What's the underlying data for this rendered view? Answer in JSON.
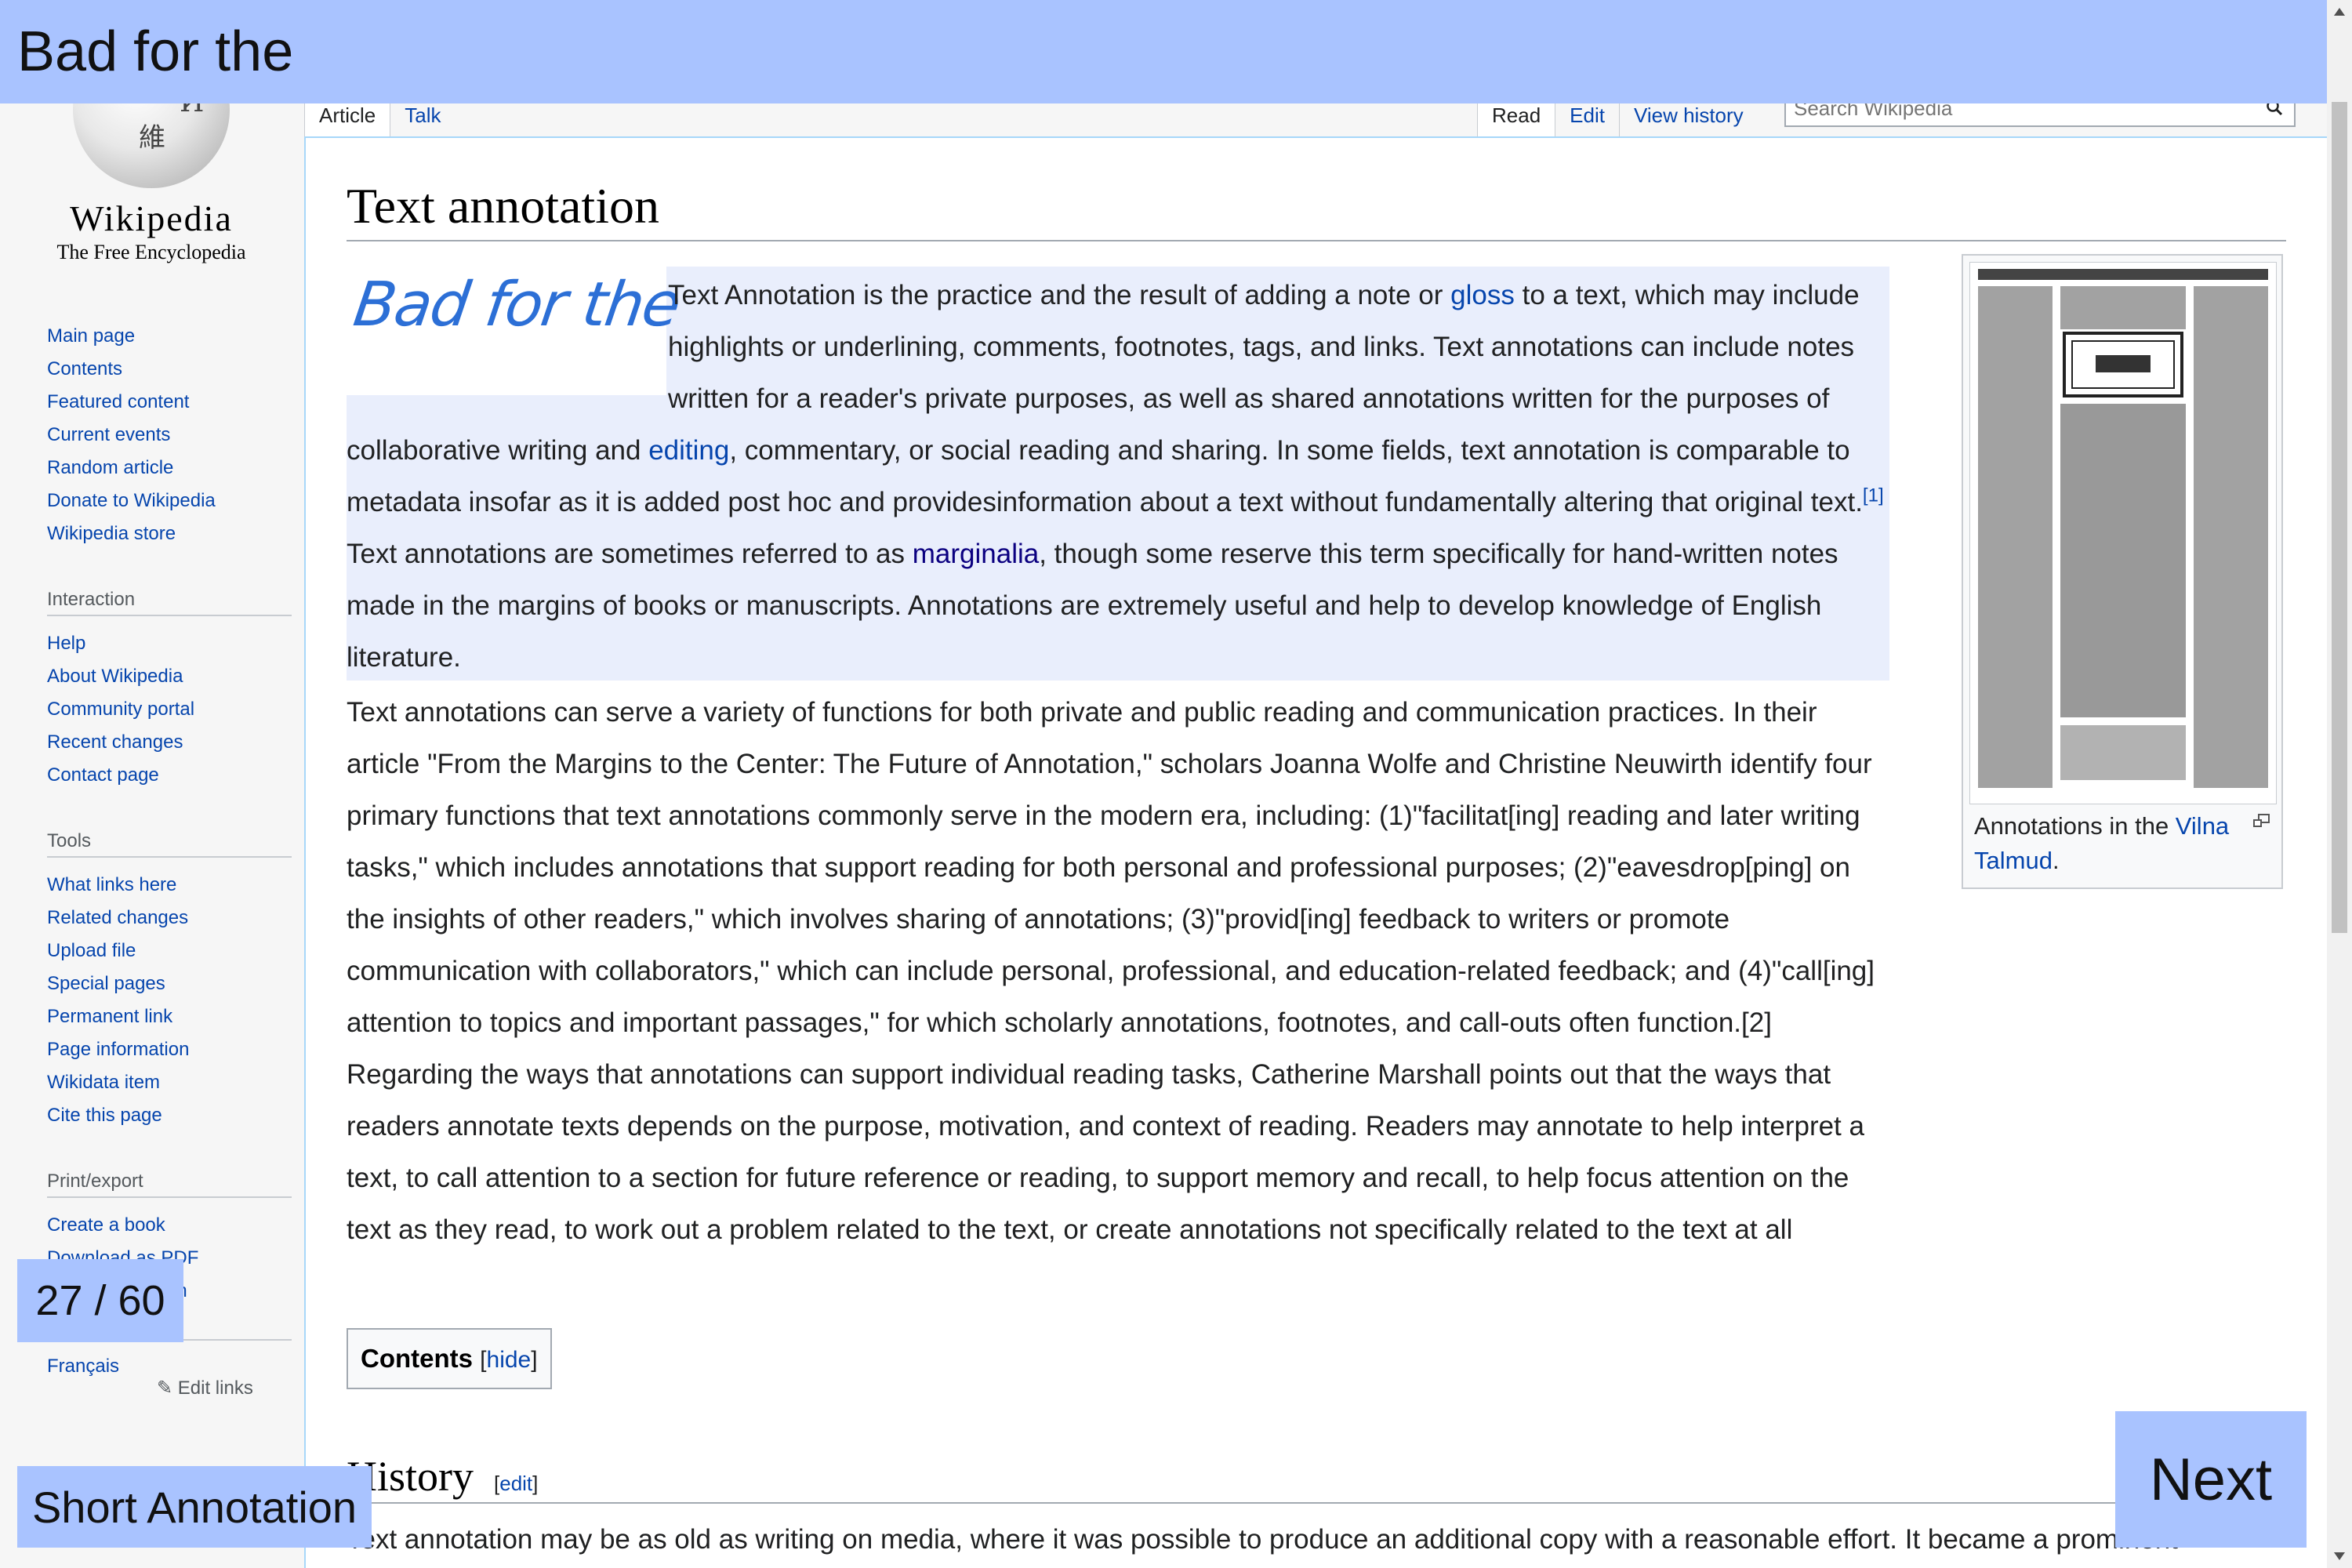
{
  "banner": {
    "text": "Bad for the"
  },
  "logo": {
    "wordmark": "Wikipedia",
    "tagline": "The Free Encyclopedia"
  },
  "sidebar": {
    "navigation": [
      "Main page",
      "Contents",
      "Featured content",
      "Current events",
      "Random article",
      "Donate to Wikipedia",
      "Wikipedia store"
    ],
    "interaction": {
      "heading": "Interaction",
      "items": [
        "Help",
        "About Wikipedia",
        "Community portal",
        "Recent changes",
        "Contact page"
      ]
    },
    "tools": {
      "heading": "Tools",
      "items": [
        "What links here",
        "Related changes",
        "Upload file",
        "Special pages",
        "Permanent link",
        "Page information",
        "Wikidata item",
        "Cite this page"
      ]
    },
    "print": {
      "heading": "Print/export",
      "items": [
        "Create a book",
        "Download as PDF",
        "Printable version"
      ]
    },
    "languages": {
      "items": [
        "Français"
      ],
      "edit_links": "Edit links"
    }
  },
  "tabs": {
    "left": [
      "Article",
      "Talk"
    ],
    "right": [
      "Read",
      "Edit",
      "View history"
    ]
  },
  "search": {
    "placeholder": "Search Wikipedia"
  },
  "article": {
    "title": "Text annotation",
    "handwriting": "Bad for the",
    "para1": {
      "t1": "Text Annotation is the practice and the result of adding a note or ",
      "link_gloss": "gloss",
      "t2": " to a text, which may include highlights or underlining, comments, footnotes, tags, and links. Text annotations can include notes written for a reader's private purposes, as well as shared annotations written for the purposes of collaborative writing and ",
      "link_editing": "editing",
      "t3": ", commentary, or social reading and sharing. In some fields, text annotation is comparable to metadata insofar as it is added post hoc and providesinformation about a text without fundamentally altering that original text.",
      "ref": "[1]",
      "t4": " Text annotations are sometimes referred to as ",
      "link_marginalia": "marginalia",
      "t5": ", though some reserve this term specifically for hand-written notes made in the margins of books or manuscripts. Annotations are extremely useful and help to develop knowledge of English literature."
    },
    "para2": "Text annotations can serve a variety of functions for both private and public reading and communication practices. In their article \"From the Margins to the Center: The Future of Annotation,\" scholars Joanna Wolfe and Christine Neuwirth identify four primary functions that text annotations commonly serve in the modern era, including: (1)\"facilitat[ing] reading and later writing tasks,\" which includes annotations that support reading for both personal and professional purposes; (2)\"eavesdrop[ping] on the insights of other readers,\" which involves sharing of annotations; (3)\"provid[ing] feedback to writers or promote communication with collaborators,\" which can include personal, professional, and education-related feedback; and (4)\"call[ing] attention to topics and important passages,\" for which scholarly annotations, footnotes, and call-outs often function.[2] Regarding the ways that annotations can support individual reading tasks, Catherine Marshall points out that the ways that readers annotate texts depends on the purpose, motivation, and context of reading. Readers may annotate to help interpret a text, to call attention to a section for future reference or reading, to support memory and recall, to help focus attention on the text as they read, to work out a problem related to the text, or create annotations not specifically related to the text at all",
    "toc": {
      "title": "Contents",
      "open": "[",
      "toggle": "hide",
      "close": "]"
    },
    "history": {
      "heading": "History",
      "edit_open": "[",
      "edit": "edit",
      "edit_close": "]"
    },
    "para3": "Text annotation may be as old as writing on media, where it was possible to produce an additional copy with a reasonable effort. It became a prominent"
  },
  "thumbnail": {
    "caption_prefix": "Annotations in the ",
    "caption_link": "Vilna Talmud",
    "caption_suffix": "."
  },
  "overlays": {
    "counter": "27 / 60",
    "short_label": "Short Annotation",
    "next_label": "Next"
  }
}
